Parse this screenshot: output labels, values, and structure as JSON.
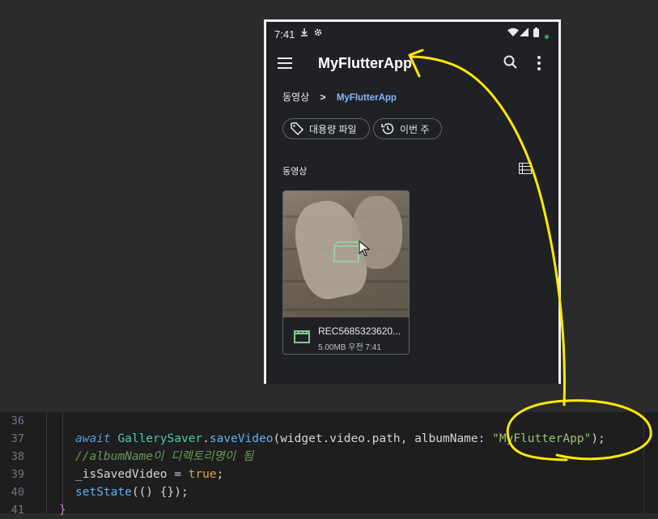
{
  "phone": {
    "status_time": "7:41",
    "app_title": "MyFlutterApp",
    "breadcrumb": {
      "root": "동영상",
      "separator": ">",
      "current": "MyFlutterApp"
    },
    "chips": [
      {
        "label": "대용량 파일",
        "icon": "tag-icon"
      },
      {
        "label": "이번 주",
        "icon": "history-icon"
      }
    ],
    "section_label": "동영상",
    "file_card": {
      "name": "REC5685323620...",
      "info": "5.00MB 우전 7:41"
    }
  },
  "editor": {
    "line_numbers": [
      "36",
      "37",
      "38",
      "39",
      "40",
      "41"
    ],
    "lines": {
      "l37": {
        "await": "await",
        "cls": "GallerySaver",
        "dot1": ".",
        "fn": "saveVideo",
        "args": "(widget.video.path, albumName: ",
        "str": "\"MyFlutterApp\"",
        "end": ");"
      },
      "l38": "//albumName이 디렉토리명이 됨",
      "l39": {
        "var": "_isSavedVideo = ",
        "val": "true",
        "end": ";"
      },
      "l40": {
        "fn": "setState",
        "rest": "(() {});"
      },
      "l41": "}"
    }
  },
  "colors": {
    "accent": "#8ab4f8",
    "annotation": "#ffea00",
    "file_icon": "#81c995"
  }
}
